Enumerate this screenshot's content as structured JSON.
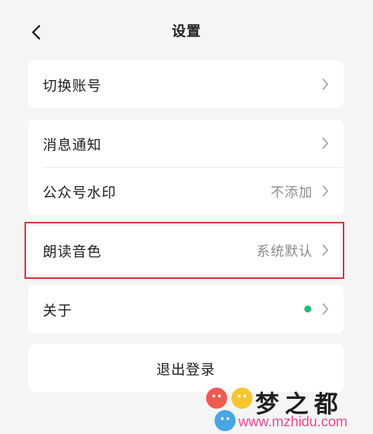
{
  "header": {
    "title": "设置",
    "back_icon": "chevron-left-icon"
  },
  "groups": [
    {
      "rows": [
        {
          "label": "切换账号",
          "value": "",
          "icon": "chevron-right-icon"
        }
      ]
    },
    {
      "rows": [
        {
          "label": "消息通知",
          "value": "",
          "icon": "chevron-right-icon"
        },
        {
          "label": "公众号水印",
          "value": "不添加",
          "icon": "chevron-right-icon"
        }
      ]
    },
    {
      "rows": [
        {
          "label": "朗读音色",
          "value": "系统默认",
          "icon": "chevron-right-icon",
          "highlighted": true
        }
      ]
    },
    {
      "rows": [
        {
          "label": "关于",
          "value": "",
          "status_dot_color": "#1dbf73",
          "icon": "chevron-right-icon"
        }
      ]
    }
  ],
  "logout": {
    "label": "退出登录"
  },
  "watermark": {
    "title": "梦之都",
    "url": "www.mzhidu.com"
  },
  "colors": {
    "background": "#f5f5f5",
    "card": "#ffffff",
    "highlight_border": "#d9262f",
    "status_dot": "#1dbf73",
    "secondary_text": "#8a8a8a"
  }
}
